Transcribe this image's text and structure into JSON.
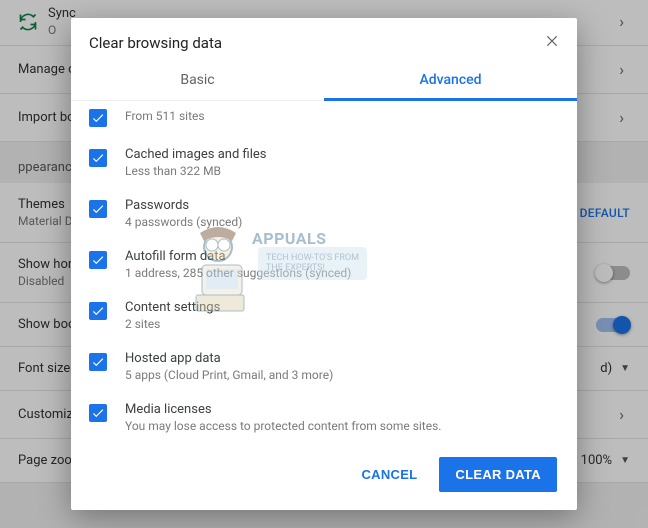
{
  "background": {
    "sync": {
      "title": "Sync",
      "sub": "O"
    },
    "rows": {
      "manage": "Manage ot",
      "import": "Import boo"
    },
    "appearance_label": "ppearance",
    "themes": {
      "title": "Themes",
      "sub": "Material Da",
      "reset": "O DEFAULT"
    },
    "show_home": {
      "title": "Show home",
      "sub": "Disabled"
    },
    "show_book": "Show book",
    "font_size": {
      "label": "Font size",
      "value": "d)"
    },
    "customize": "Customize",
    "page_zoom": {
      "label": "Page zoom",
      "value": "100%"
    }
  },
  "dialog": {
    "title": "Clear browsing data",
    "tabs": {
      "basic": "Basic",
      "advanced": "Advanced"
    },
    "items": [
      {
        "label": "",
        "sub": "From 511 sites"
      },
      {
        "label": "Cached images and files",
        "sub": "Less than 322 MB"
      },
      {
        "label": "Passwords",
        "sub": "4 passwords (synced)"
      },
      {
        "label": "Autofill form data",
        "sub": "1 address, 285 other suggestions (synced)"
      },
      {
        "label": "Content settings",
        "sub": "2 sites"
      },
      {
        "label": "Hosted app data",
        "sub": "5 apps (Cloud Print, Gmail, and 3 more)"
      },
      {
        "label": "Media licenses",
        "sub": "You may lose access to protected content from some sites."
      }
    ],
    "buttons": {
      "cancel": "CANCEL",
      "clear": "CLEAR DATA"
    }
  },
  "watermark": {
    "brand": "APPUALS",
    "tag1": "TECH HOW-TO'S FROM",
    "tag2": "THE EXPERTS!"
  }
}
